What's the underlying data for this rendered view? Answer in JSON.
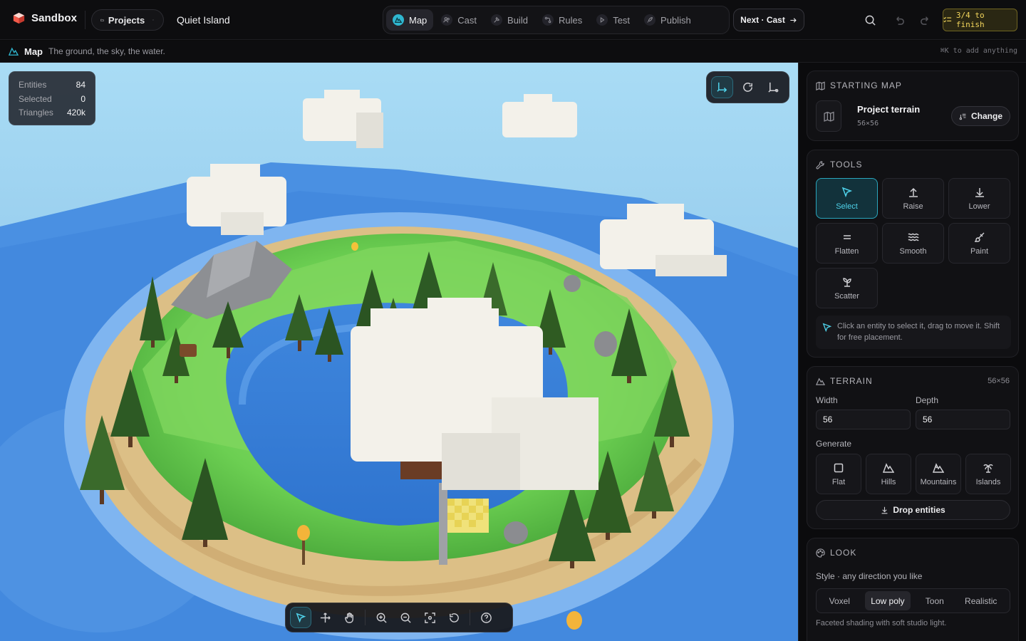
{
  "app": {
    "name": "Sandbox",
    "project_name": "Quiet Island"
  },
  "header": {
    "projects_label": "Projects",
    "steps": [
      {
        "label": "Map",
        "icon": "map-icon",
        "active": true
      },
      {
        "label": "Cast",
        "icon": "users-icon",
        "active": false
      },
      {
        "label": "Build",
        "icon": "hammer-icon",
        "active": false
      },
      {
        "label": "Rules",
        "icon": "rules-icon",
        "active": false
      },
      {
        "label": "Test",
        "icon": "play-icon",
        "active": false
      },
      {
        "label": "Publish",
        "icon": "rocket-icon",
        "active": false
      }
    ],
    "next_label": "Next · Cast",
    "progress_label": "3/4 to finish",
    "accent": "#2fb6cf",
    "progress_color": "#f2d55c"
  },
  "subbar": {
    "title": "Map",
    "description": "The ground, the sky, the water.",
    "hint": "⌘K to add anything"
  },
  "viewport": {
    "stats": [
      {
        "label": "Entities",
        "value": "84"
      },
      {
        "label": "Selected",
        "value": "0"
      },
      {
        "label": "Triangles",
        "value": "420k"
      }
    ],
    "camera_controls": [
      "axes-icon",
      "rotate-icon",
      "axes-alt-icon"
    ],
    "toolbar": [
      "pointer-icon",
      "move-icon",
      "hand-icon",
      "zoom-in-icon",
      "zoom-out-icon",
      "focus-icon",
      "reset-view-icon",
      "help-icon"
    ]
  },
  "panel": {
    "starting_map": {
      "heading": "STARTING MAP",
      "title": "Project terrain",
      "size": "56×56",
      "change_label": "Change"
    },
    "tools": {
      "heading": "TOOLS",
      "items": [
        {
          "label": "Select",
          "icon": "cursor-icon",
          "active": true
        },
        {
          "label": "Raise",
          "icon": "arrow-up-icon",
          "active": false
        },
        {
          "label": "Lower",
          "icon": "arrow-down-icon",
          "active": false
        },
        {
          "label": "Flatten",
          "icon": "equals-icon",
          "active": false
        },
        {
          "label": "Smooth",
          "icon": "waves-icon",
          "active": false
        },
        {
          "label": "Paint",
          "icon": "brush-icon",
          "active": false
        },
        {
          "label": "Scatter",
          "icon": "sprout-icon",
          "active": false
        }
      ],
      "hint": "Click an entity to select it, drag to move it. Shift for free placement."
    },
    "terrain": {
      "heading": "TERRAIN",
      "size": "56×56",
      "width_label": "Width",
      "width_value": "56",
      "depth_label": "Depth",
      "depth_value": "56",
      "generate_label": "Generate",
      "generate": [
        {
          "label": "Flat",
          "icon": "square-icon"
        },
        {
          "label": "Hills",
          "icon": "hills-icon"
        },
        {
          "label": "Mountains",
          "icon": "mountains-icon"
        },
        {
          "label": "Islands",
          "icon": "palm-icon"
        }
      ],
      "drop_label": "Drop entities"
    },
    "look": {
      "heading": "LOOK",
      "style_label": "Style · any direction you like",
      "styles": [
        {
          "label": "Voxel",
          "active": false
        },
        {
          "label": "Low poly",
          "active": true
        },
        {
          "label": "Toon",
          "active": false
        },
        {
          "label": "Realistic",
          "active": false
        }
      ],
      "style_desc": "Faceted shading with soft studio light."
    }
  }
}
